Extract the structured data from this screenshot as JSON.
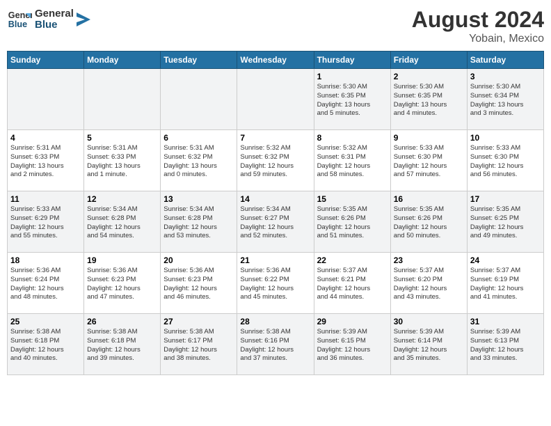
{
  "header": {
    "logo_line1": "General",
    "logo_line2": "Blue",
    "title": "August 2024",
    "subtitle": "Yobain, Mexico"
  },
  "weekdays": [
    "Sunday",
    "Monday",
    "Tuesday",
    "Wednesday",
    "Thursday",
    "Friday",
    "Saturday"
  ],
  "weeks": [
    [
      {
        "day": "",
        "info": ""
      },
      {
        "day": "",
        "info": ""
      },
      {
        "day": "",
        "info": ""
      },
      {
        "day": "",
        "info": ""
      },
      {
        "day": "1",
        "info": "Sunrise: 5:30 AM\nSunset: 6:35 PM\nDaylight: 13 hours\nand 5 minutes."
      },
      {
        "day": "2",
        "info": "Sunrise: 5:30 AM\nSunset: 6:35 PM\nDaylight: 13 hours\nand 4 minutes."
      },
      {
        "day": "3",
        "info": "Sunrise: 5:30 AM\nSunset: 6:34 PM\nDaylight: 13 hours\nand 3 minutes."
      }
    ],
    [
      {
        "day": "4",
        "info": "Sunrise: 5:31 AM\nSunset: 6:33 PM\nDaylight: 13 hours\nand 2 minutes."
      },
      {
        "day": "5",
        "info": "Sunrise: 5:31 AM\nSunset: 6:33 PM\nDaylight: 13 hours\nand 1 minute."
      },
      {
        "day": "6",
        "info": "Sunrise: 5:31 AM\nSunset: 6:32 PM\nDaylight: 13 hours\nand 0 minutes."
      },
      {
        "day": "7",
        "info": "Sunrise: 5:32 AM\nSunset: 6:32 PM\nDaylight: 12 hours\nand 59 minutes."
      },
      {
        "day": "8",
        "info": "Sunrise: 5:32 AM\nSunset: 6:31 PM\nDaylight: 12 hours\nand 58 minutes."
      },
      {
        "day": "9",
        "info": "Sunrise: 5:33 AM\nSunset: 6:30 PM\nDaylight: 12 hours\nand 57 minutes."
      },
      {
        "day": "10",
        "info": "Sunrise: 5:33 AM\nSunset: 6:30 PM\nDaylight: 12 hours\nand 56 minutes."
      }
    ],
    [
      {
        "day": "11",
        "info": "Sunrise: 5:33 AM\nSunset: 6:29 PM\nDaylight: 12 hours\nand 55 minutes."
      },
      {
        "day": "12",
        "info": "Sunrise: 5:34 AM\nSunset: 6:28 PM\nDaylight: 12 hours\nand 54 minutes."
      },
      {
        "day": "13",
        "info": "Sunrise: 5:34 AM\nSunset: 6:28 PM\nDaylight: 12 hours\nand 53 minutes."
      },
      {
        "day": "14",
        "info": "Sunrise: 5:34 AM\nSunset: 6:27 PM\nDaylight: 12 hours\nand 52 minutes."
      },
      {
        "day": "15",
        "info": "Sunrise: 5:35 AM\nSunset: 6:26 PM\nDaylight: 12 hours\nand 51 minutes."
      },
      {
        "day": "16",
        "info": "Sunrise: 5:35 AM\nSunset: 6:26 PM\nDaylight: 12 hours\nand 50 minutes."
      },
      {
        "day": "17",
        "info": "Sunrise: 5:35 AM\nSunset: 6:25 PM\nDaylight: 12 hours\nand 49 minutes."
      }
    ],
    [
      {
        "day": "18",
        "info": "Sunrise: 5:36 AM\nSunset: 6:24 PM\nDaylight: 12 hours\nand 48 minutes."
      },
      {
        "day": "19",
        "info": "Sunrise: 5:36 AM\nSunset: 6:23 PM\nDaylight: 12 hours\nand 47 minutes."
      },
      {
        "day": "20",
        "info": "Sunrise: 5:36 AM\nSunset: 6:23 PM\nDaylight: 12 hours\nand 46 minutes."
      },
      {
        "day": "21",
        "info": "Sunrise: 5:36 AM\nSunset: 6:22 PM\nDaylight: 12 hours\nand 45 minutes."
      },
      {
        "day": "22",
        "info": "Sunrise: 5:37 AM\nSunset: 6:21 PM\nDaylight: 12 hours\nand 44 minutes."
      },
      {
        "day": "23",
        "info": "Sunrise: 5:37 AM\nSunset: 6:20 PM\nDaylight: 12 hours\nand 43 minutes."
      },
      {
        "day": "24",
        "info": "Sunrise: 5:37 AM\nSunset: 6:19 PM\nDaylight: 12 hours\nand 41 minutes."
      }
    ],
    [
      {
        "day": "25",
        "info": "Sunrise: 5:38 AM\nSunset: 6:18 PM\nDaylight: 12 hours\nand 40 minutes."
      },
      {
        "day": "26",
        "info": "Sunrise: 5:38 AM\nSunset: 6:18 PM\nDaylight: 12 hours\nand 39 minutes."
      },
      {
        "day": "27",
        "info": "Sunrise: 5:38 AM\nSunset: 6:17 PM\nDaylight: 12 hours\nand 38 minutes."
      },
      {
        "day": "28",
        "info": "Sunrise: 5:38 AM\nSunset: 6:16 PM\nDaylight: 12 hours\nand 37 minutes."
      },
      {
        "day": "29",
        "info": "Sunrise: 5:39 AM\nSunset: 6:15 PM\nDaylight: 12 hours\nand 36 minutes."
      },
      {
        "day": "30",
        "info": "Sunrise: 5:39 AM\nSunset: 6:14 PM\nDaylight: 12 hours\nand 35 minutes."
      },
      {
        "day": "31",
        "info": "Sunrise: 5:39 AM\nSunset: 6:13 PM\nDaylight: 12 hours\nand 33 minutes."
      }
    ]
  ]
}
